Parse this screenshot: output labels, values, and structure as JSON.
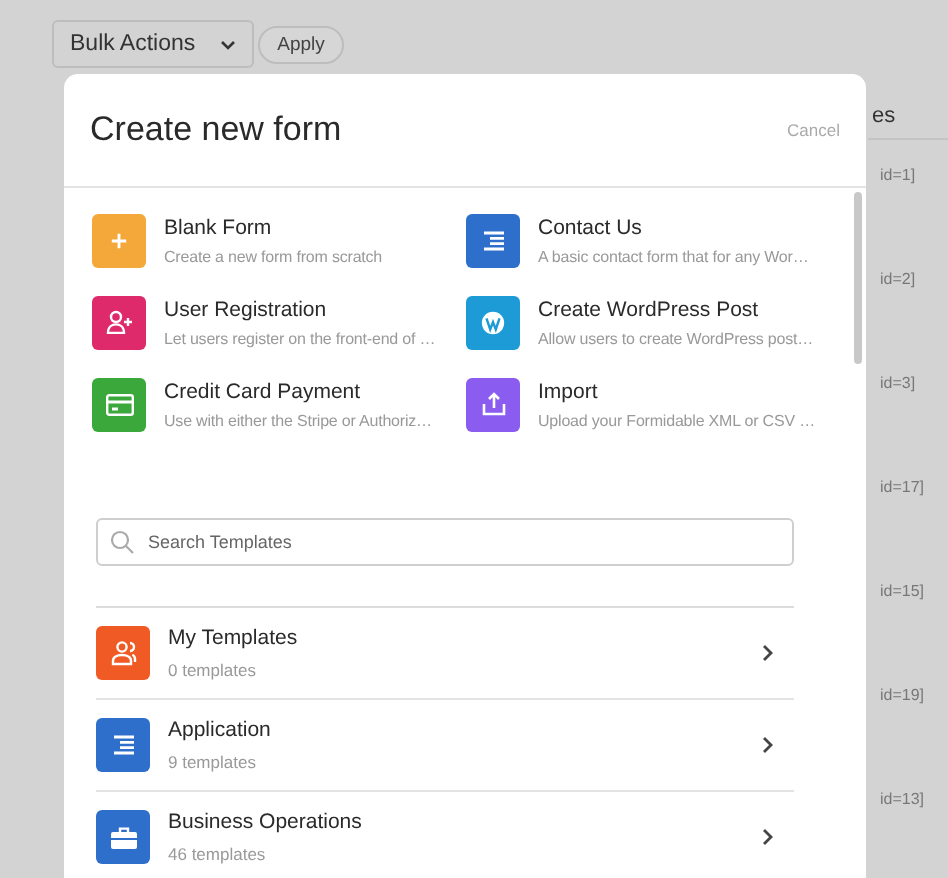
{
  "toolbar": {
    "bulk_actions": "Bulk Actions",
    "apply": "Apply"
  },
  "background_table": {
    "column_header": "es",
    "rows": [
      "id=1]",
      "id=2]",
      "id=3]",
      "id=17]",
      "id=15]",
      "id=19]",
      "id=13]"
    ]
  },
  "modal": {
    "title": "Create new form",
    "cancel": "Cancel",
    "options": [
      {
        "kind": "plus",
        "color": "#f5a83a",
        "title": "Blank Form",
        "description": "Create a new form from scratch"
      },
      {
        "kind": "list",
        "color": "#2f6fcc",
        "title": "Contact Us",
        "description": "A basic contact form that for any Wor…"
      },
      {
        "kind": "user",
        "color": "#de2a6a",
        "title": "User Registration",
        "description": "Let users register on the front-end of …"
      },
      {
        "kind": "wordpress",
        "color": "#1c9bd6",
        "title": "Create WordPress Post",
        "description": "Allow users to create WordPress post…"
      },
      {
        "kind": "card",
        "color": "#3aa83a",
        "title": "Credit Card Payment",
        "description": "Use with either the Stripe or Authoriz…"
      },
      {
        "kind": "upload",
        "color": "#8a5cf0",
        "title": "Import",
        "description": "Upload your Formidable XML or CSV …"
      }
    ],
    "search": {
      "placeholder": "Search Templates"
    },
    "categories": [
      {
        "kind": "users",
        "color": "#f05a24",
        "title": "My Templates",
        "count": "0 templates"
      },
      {
        "kind": "list",
        "color": "#2f6fcc",
        "title": "Application",
        "count": "9 templates"
      },
      {
        "kind": "briefcase",
        "color": "#2f6fcc",
        "title": "Business Operations",
        "count": "46 templates"
      }
    ]
  }
}
